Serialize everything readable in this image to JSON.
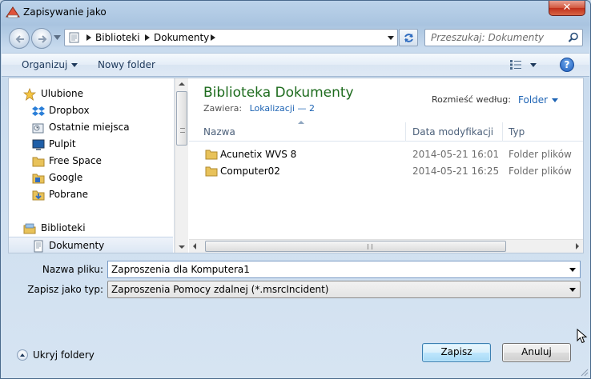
{
  "window": {
    "title": "Zapisywanie jako",
    "close_glyph": "✕"
  },
  "nav": {
    "back_icon": "back-arrow-icon",
    "forward_icon": "forward-arrow-icon",
    "breadcrumb": [
      "Biblioteki",
      "Dokumenty"
    ],
    "search_placeholder": "Przeszukaj: Dokumenty"
  },
  "toolbar": {
    "organize_label": "Organizuj",
    "new_folder_label": "Nowy folder",
    "help_glyph": "?"
  },
  "sidebar": {
    "items": [
      {
        "label": "Ulubione",
        "icon": "star-icon"
      },
      {
        "label": "Dropbox",
        "icon": "dropbox-icon"
      },
      {
        "label": "Ostatnie miejsca",
        "icon": "recent-places-icon"
      },
      {
        "label": "Pulpit",
        "icon": "desktop-icon"
      },
      {
        "label": "Free Space",
        "icon": "folder-icon"
      },
      {
        "label": "Google",
        "icon": "folder-icon"
      },
      {
        "label": "Pobrane",
        "icon": "downloads-icon"
      },
      {
        "label": "Biblioteki",
        "icon": "libraries-icon"
      },
      {
        "label": "Dokumenty",
        "icon": "documents-icon",
        "selected": true
      }
    ]
  },
  "library": {
    "title": "Biblioteka Dokumenty",
    "includes_label": "Zawiera:",
    "locations_link": "Lokalizacji — 2",
    "arrange_label": "Rozmieść według:",
    "arrange_value": "Folder"
  },
  "columns": {
    "name": "Nazwa",
    "date": "Data modyfikacji",
    "type": "Typ"
  },
  "files": [
    {
      "name": "Acunetix WVS 8",
      "date": "2014-05-21 16:01",
      "type": "Folder plików"
    },
    {
      "name": "Computer02",
      "date": "2014-05-21 16:25",
      "type": "Folder plików"
    }
  ],
  "form": {
    "filename_label": "Nazwa pliku:",
    "filename_value": "Zaproszenia dla Komputera1",
    "filetype_label": "Zapisz jako typ:",
    "filetype_value": "Zaproszenia Pomocy zdalnej (*.msrcIncident)"
  },
  "footer": {
    "hide_folders_label": "Ukryj foldery",
    "save_label": "Zapisz",
    "cancel_label": "Anuluj"
  },
  "colors": {
    "library_title": "#1d6b1d",
    "link": "#1e64b4",
    "close_button": "#c0301b"
  }
}
